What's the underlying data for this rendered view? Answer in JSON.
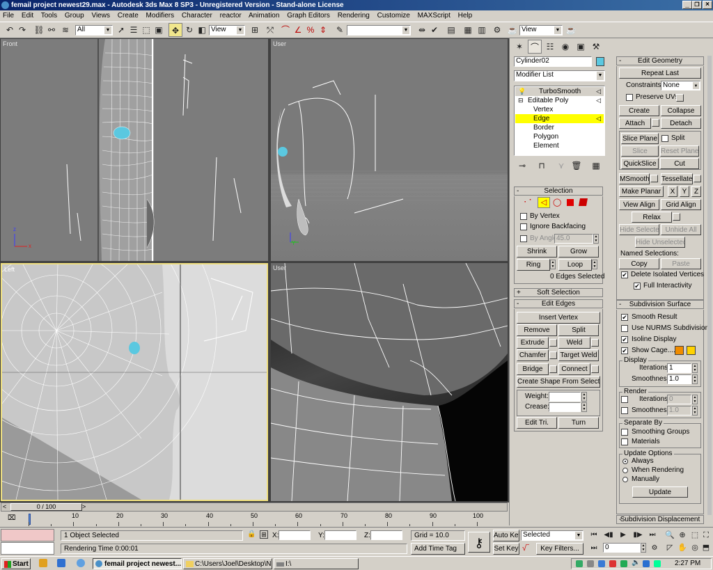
{
  "window": {
    "title": "femail project newest29.max - Autodesk 3ds Max 8 SP3 - Unregistered Version - Stand-alone License"
  },
  "menu": [
    "File",
    "Edit",
    "Tools",
    "Group",
    "Views",
    "Create",
    "Modifiers",
    "Character",
    "reactor",
    "Animation",
    "Graph Editors",
    "Rendering",
    "Customize",
    "MAXScript",
    "Help"
  ],
  "toolbar": {
    "selection_filter": "All",
    "ref_coord": "View",
    "ref_coord2": "View",
    "named_selection": ""
  },
  "viewports": {
    "front": "Front",
    "user_top": "User",
    "left": "Left",
    "user_bottom": "User"
  },
  "command_panel": {
    "object_name": "Cylinder02",
    "modifier_list": "Modifier List",
    "stack": [
      "TurboSmooth",
      "Editable Poly",
      "Vertex",
      "Edge",
      "Border",
      "Polygon",
      "Element"
    ],
    "selection": {
      "header": "Selection",
      "by_vertex": "By Vertex",
      "ignore_backfacing": "Ignore Backfacing",
      "by_angle": "By Angle:",
      "angle_value": "45.0",
      "shrink": "Shrink",
      "grow": "Grow",
      "ring": "Ring",
      "loop": "Loop",
      "status": "0 Edges Selected"
    },
    "soft_selection": "Soft Selection",
    "edit_edges": {
      "header": "Edit Edges",
      "insert_vertex": "Insert Vertex",
      "remove": "Remove",
      "split": "Split",
      "extrude": "Extrude",
      "weld": "Weld",
      "chamfer": "Chamfer",
      "target_weld": "Target Weld",
      "bridge": "Bridge",
      "connect": "Connect",
      "create_shape": "Create Shape From Selection",
      "weight": "Weight:",
      "crease": "Crease:",
      "edit_tri": "Edit Tri.",
      "turn": "Turn"
    },
    "edit_geometry": {
      "header": "Edit Geometry",
      "repeat_last": "Repeat Last",
      "constraints": "Constraints:",
      "constraints_value": "None",
      "preserve_uvs": "Preserve UVs",
      "create": "Create",
      "collapse": "Collapse",
      "attach": "Attach",
      "detach": "Detach",
      "slice_plane": "Slice Plane",
      "split": "Split",
      "slice": "Slice",
      "reset_plane": "Reset Plane",
      "quickslice": "QuickSlice",
      "cut": "Cut",
      "msmooth": "MSmooth",
      "tessellate": "Tessellate",
      "make_planar": "Make Planar",
      "x": "X",
      "y": "Y",
      "z": "Z",
      "view_align": "View Align",
      "grid_align": "Grid Align",
      "relax": "Relax",
      "hide_selected": "Hide Selected",
      "unhide_all": "Unhide All",
      "hide_unselected": "Hide Unselected",
      "named_selections": "Named Selections:",
      "copy": "Copy",
      "paste": "Paste",
      "delete_isolated": "Delete Isolated Vertices",
      "full_interactivity": "Full Interactivity"
    },
    "subdivision_surface": {
      "header": "Subdivision Surface",
      "smooth_result": "Smooth Result",
      "use_nurms": "Use NURMS Subdivision",
      "isoline_display": "Isoline Display",
      "show_cage": "Show Cage......",
      "display": "Display",
      "iterations": "Iterations:",
      "iterations_value": "1",
      "smoothness": "Smoothness:",
      "smoothness_value": "1.0",
      "render": "Render",
      "r_iterations_value": "0",
      "r_smoothness_value": "1.0",
      "separate_by": "Separate By",
      "smoothing_groups": "Smoothing Groups",
      "materials": "Materials",
      "update_options": "Update Options",
      "always": "Always",
      "when_rendering": "When Rendering",
      "manually": "Manually",
      "update": "Update"
    },
    "subdivision_displacement": "Subdivision Displacement"
  },
  "timeline": {
    "frame": "0 / 100",
    "ticks": [
      "0",
      "10",
      "20",
      "30",
      "40",
      "50",
      "60",
      "70",
      "80",
      "90",
      "100"
    ]
  },
  "status": {
    "selected": "1 Object Selected",
    "rendering_time": "Rendering Time  0:00:01",
    "x_label": "X:",
    "y_label": "Y:",
    "z_label": "Z:",
    "grid": "Grid = 10.0",
    "add_time_tag": "Add Time Tag",
    "auto_key": "Auto Key",
    "set_key": "Set Key",
    "key_mode": "Selected",
    "key_filters": "Key Filters...",
    "current_frame": "0"
  },
  "taskbar": {
    "start": "Start",
    "task1": "femail project newest...",
    "task2": "C:\\Users\\Joel\\Desktop\\N...",
    "task3": "I:\\",
    "clock": "2:27 PM"
  },
  "colors": {
    "titlebar": "#0a246a",
    "selected_stack": "#ffff00",
    "cage1": "#f08c00",
    "cage2": "#ffd200",
    "active_viewport": "#f0e080"
  }
}
